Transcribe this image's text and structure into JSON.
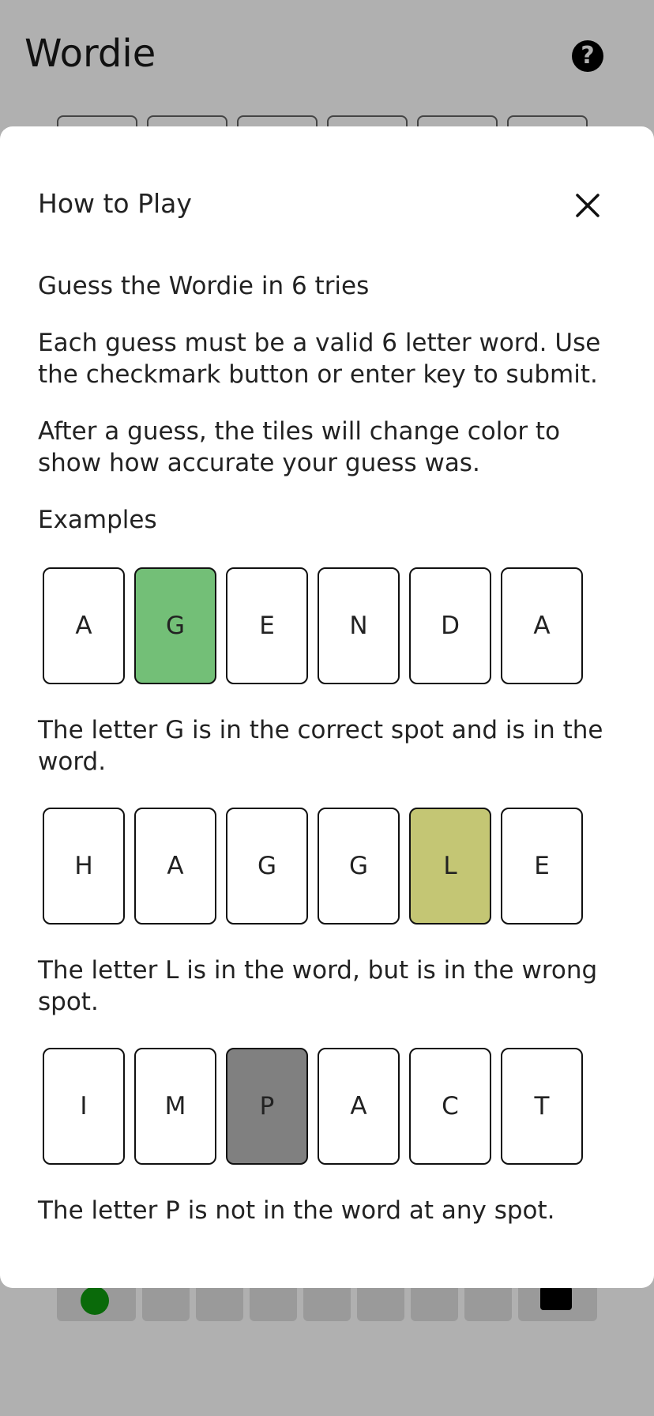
{
  "app": {
    "title": "Wordie",
    "help_icon": "?"
  },
  "modal": {
    "title": "How to Play",
    "close_icon": "close-icon",
    "intro": "Guess the Wordie in 6 tries",
    "rules": "Each guess must be a valid 6 letter word. Use the checkmark button or enter key to submit.",
    "after": "After a guess, the tiles will change color to show how accurate your guess was.",
    "examples_heading": "Examples",
    "examples": [
      {
        "letters": [
          "A",
          "G",
          "E",
          "N",
          "D",
          "A"
        ],
        "highlight_index": 1,
        "state": "correct",
        "description": "The letter G is in the correct spot and is in the word."
      },
      {
        "letters": [
          "H",
          "A",
          "G",
          "G",
          "L",
          "E"
        ],
        "highlight_index": 4,
        "state": "present",
        "description": "The letter L is in the word, but is in the wrong spot."
      },
      {
        "letters": [
          "I",
          "M",
          "P",
          "A",
          "C",
          "T"
        ],
        "highlight_index": 2,
        "state": "absent",
        "description": "The letter P is not in the word at any spot."
      }
    ]
  },
  "colors": {
    "correct": "#73bf77",
    "present": "#c4c674",
    "absent": "#808080",
    "overlay": "#b0b0b0"
  }
}
